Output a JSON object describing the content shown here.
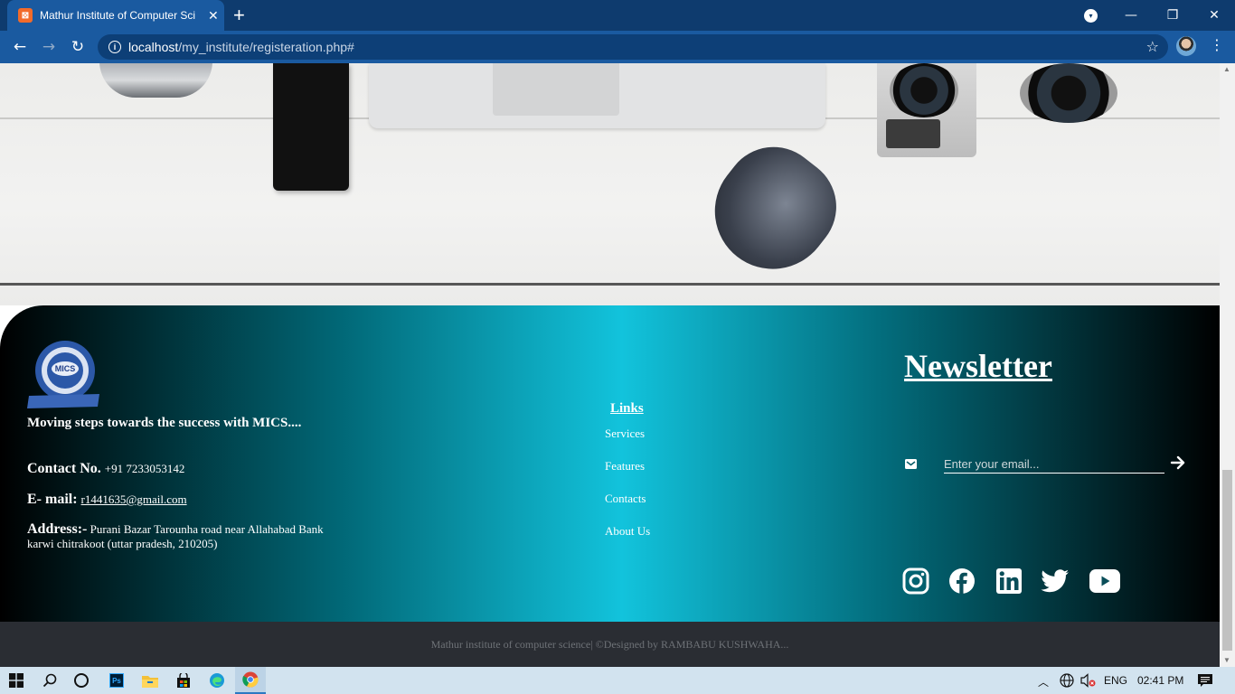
{
  "browser": {
    "tab_title": "Mathur Institute of Computer Sci",
    "tab_close": "✕",
    "new_tab": "+",
    "url_host": "localhost",
    "url_path": "/my_institute/registeration.php#"
  },
  "footer": {
    "logo_text": "MICS",
    "tagline": "Moving steps towards the success with MICS....",
    "contact_label": "Contact No.",
    "contact_value": "+91 7233053142",
    "email_label": "E- mail:",
    "email_value": "r1441635@gmail.com",
    "address_label": "Address:-",
    "address_value": "Purani Bazar Tarounha road near Allahabad Bank karwi chitrakoot (uttar pradesh, 210205)",
    "links_heading": "Links",
    "links": [
      "Services",
      "Features",
      "Contacts",
      "About Us"
    ],
    "newsletter_heading": "Newsletter",
    "email_placeholder": "Enter your email...",
    "social_icons": [
      "instagram-icon",
      "facebook-icon",
      "linkedin-icon",
      "twitter-icon",
      "youtube-icon"
    ],
    "copyright": "Mathur institute of computer science| ©Designed by RAMBABU KUSHWAHA..."
  },
  "taskbar": {
    "language": "ENG",
    "time": "02:41 PM"
  },
  "colors": {
    "footer_gradient_center": "#12c3dc",
    "footer_gradient_edge": "#000000",
    "browser_frame": "#0e3b6e"
  }
}
